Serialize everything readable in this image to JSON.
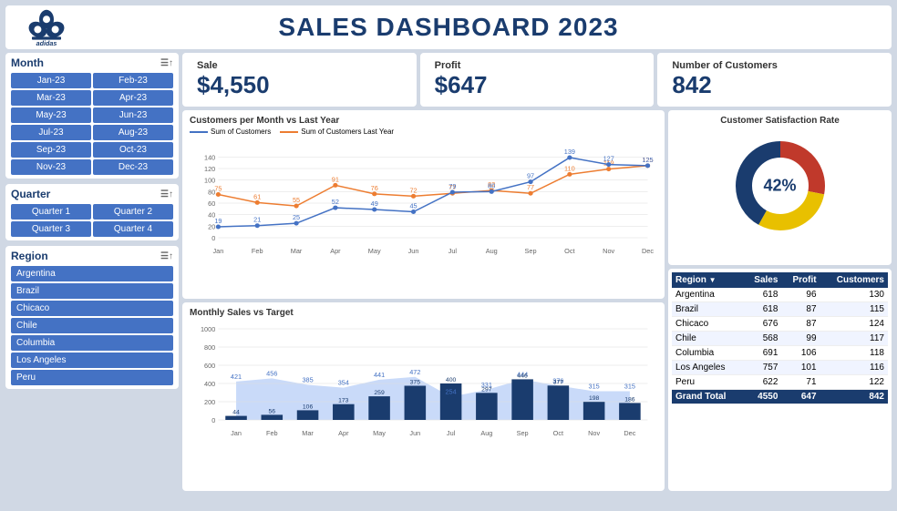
{
  "header": {
    "title": "SALES DASHBOARD 2023",
    "logo_text": "adidas"
  },
  "sidebar": {
    "month_label": "Month",
    "months": [
      "Jan-23",
      "Feb-23",
      "Mar-23",
      "Apr-23",
      "May-23",
      "Jun-23",
      "Jul-23",
      "Aug-23",
      "Sep-23",
      "Oct-23",
      "Nov-23",
      "Dec-23"
    ],
    "quarter_label": "Quarter",
    "quarters": [
      "Quarter 1",
      "Quarter 2",
      "Quarter 3",
      "Quarter 4"
    ],
    "region_label": "Region",
    "regions": [
      "Argentina",
      "Brazil",
      "Chicaco",
      "Chile",
      "Columbia",
      "Los Angeles",
      "Peru"
    ]
  },
  "kpi": {
    "sale_label": "Sale",
    "sale_value": "$4,550",
    "profit_label": "Profit",
    "profit_value": "$647",
    "customers_label": "Number of Customers",
    "customers_value": "842"
  },
  "line_chart": {
    "title": "Customers per Month vs Last Year",
    "legend_current": "Sum of Customers",
    "legend_last": "Sum of Customers Last Year",
    "months": [
      "Jan",
      "Feb",
      "Mar",
      "Apr",
      "May",
      "Jun",
      "Jul",
      "Aug",
      "Sep",
      "Oct",
      "Nov",
      "Dec"
    ],
    "current": [
      19,
      21,
      25,
      52,
      49,
      45,
      79,
      80,
      97,
      139,
      127,
      125
    ],
    "last_year": [
      75,
      61,
      55,
      91,
      76,
      72,
      77,
      82,
      77,
      110,
      119,
      125
    ]
  },
  "bar_chart": {
    "title": "Monthly Sales vs Target",
    "months": [
      "Jan",
      "Feb",
      "Mar",
      "Apr",
      "May",
      "Jun",
      "Jul",
      "Aug",
      "Sep",
      "Oct",
      "Nov",
      "Dec"
    ],
    "actual": [
      44,
      56,
      106,
      173,
      259,
      375,
      400,
      297,
      446,
      377,
      198,
      186
    ],
    "target": [
      421,
      456,
      385,
      354,
      441,
      472,
      254,
      331,
      444,
      376,
      315,
      315
    ]
  },
  "satisfaction": {
    "title": "Customer Satisfaction Rate",
    "percentage": "42%",
    "segments": [
      {
        "color": "#e8c000",
        "value": 30
      },
      {
        "color": "#c0392b",
        "value": 28
      },
      {
        "color": "#1a3c6e",
        "value": 42
      }
    ]
  },
  "table": {
    "headers": [
      "Region",
      "Sales",
      "Profit",
      "Customers"
    ],
    "rows": [
      [
        "Argentina",
        "618",
        "96",
        "130"
      ],
      [
        "Brazil",
        "618",
        "87",
        "115"
      ],
      [
        "Chicaco",
        "676",
        "87",
        "124"
      ],
      [
        "Chile",
        "568",
        "99",
        "117"
      ],
      [
        "Columbia",
        "691",
        "106",
        "118"
      ],
      [
        "Los Angeles",
        "757",
        "101",
        "116"
      ],
      [
        "Peru",
        "622",
        "71",
        "122"
      ],
      [
        "Grand Total",
        "4550",
        "647",
        "842"
      ]
    ]
  }
}
